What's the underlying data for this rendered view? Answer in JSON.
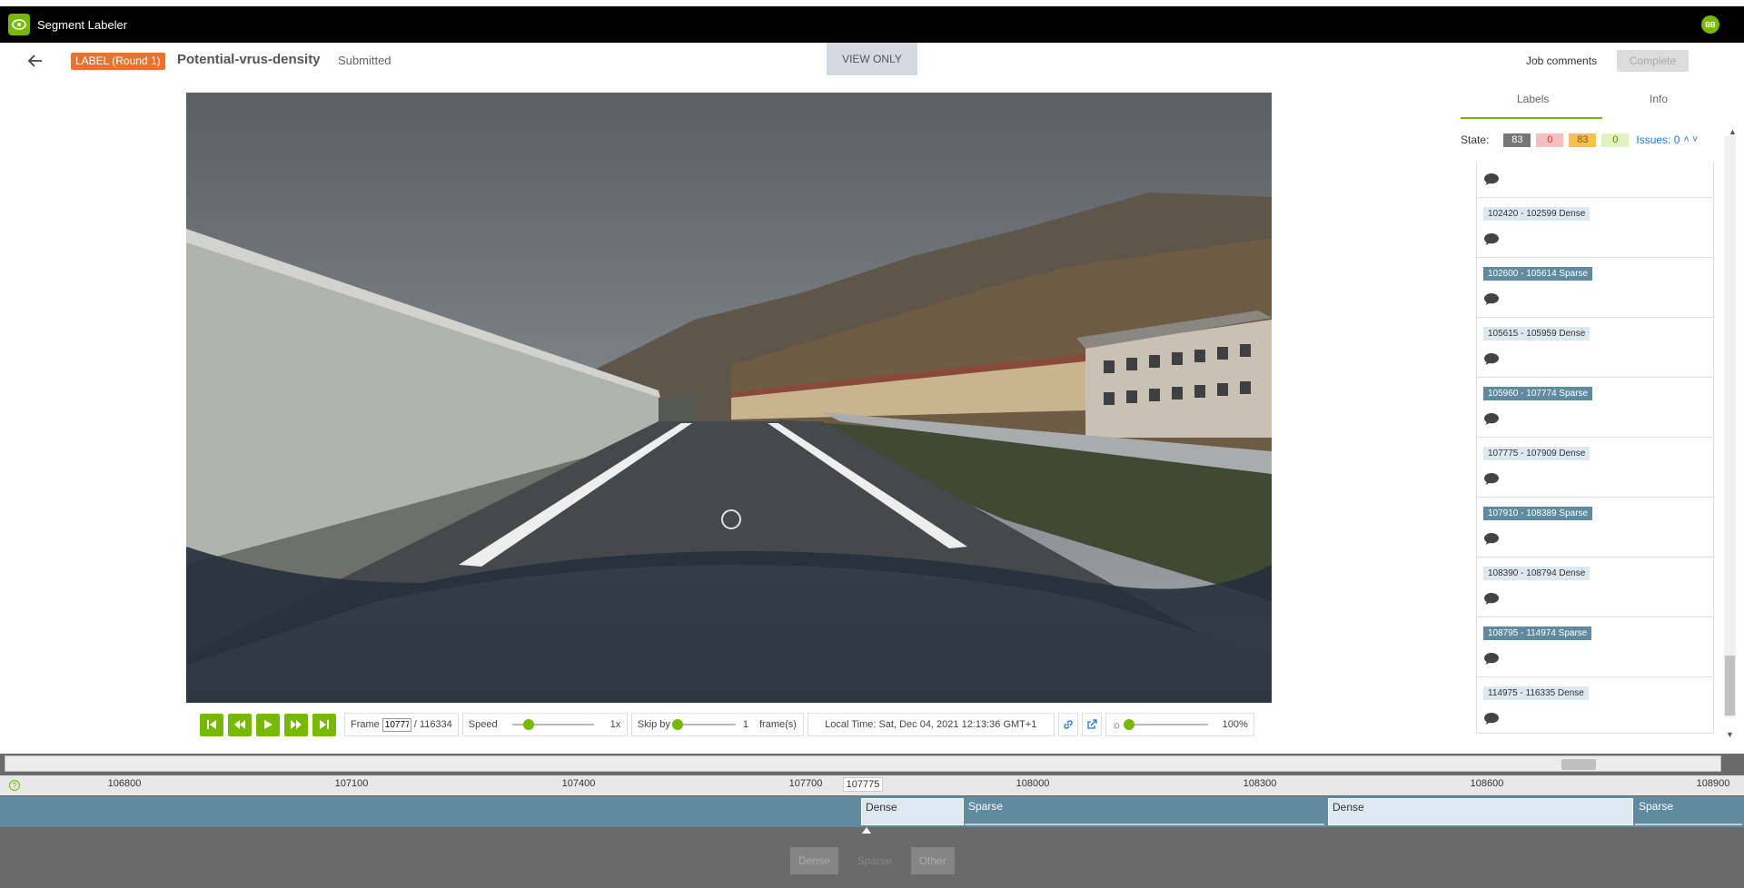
{
  "app": {
    "title": "Segment Labeler",
    "user_initials": "BB"
  },
  "header": {
    "round_badge": "LABEL (Round 1)",
    "job_name": "Potential-vrus-density",
    "status": "Submitted",
    "view_only": "VIEW ONLY",
    "job_comments": "Job comments",
    "complete": "Complete"
  },
  "player": {
    "frame_label": "Frame",
    "frame_value": "10777",
    "frame_total": "/ 116334",
    "speed_label": "Speed",
    "speed_value": "1x",
    "skip_label": "Skip by",
    "skip_value": "1",
    "skip_unit": "frame(s)",
    "local_time": "Local Time: Sat, Dec 04, 2021 12:13:36 GMT+1",
    "brightness": "100%",
    "speed_level": 0.2,
    "skip_level": 0.0,
    "brightness_level": 0.0
  },
  "panel": {
    "tabs": [
      "Labels",
      "Info"
    ],
    "state_label": "State:",
    "state_counts": [
      {
        "value": "83",
        "bg": "#777777",
        "fg": "#ffffff"
      },
      {
        "value": "0",
        "bg": "#f7c0c0",
        "fg": "#cc3333"
      },
      {
        "value": "83",
        "bg": "#f7c04a",
        "fg": "#8a5a00"
      },
      {
        "value": "0",
        "bg": "#dff3c0",
        "fg": "#5a8a00"
      }
    ],
    "issues": "Issues: 0",
    "segments": [
      {
        "label": "",
        "type": ""
      },
      {
        "label": "102420 - 102599 Dense",
        "type": "dense"
      },
      {
        "label": "102600 - 105614 Sparse",
        "type": "sparse"
      },
      {
        "label": "105615 - 105959 Dense",
        "type": "dense"
      },
      {
        "label": "105960 - 107774 Sparse",
        "type": "sparse"
      },
      {
        "label": "107775 - 107909 Dense",
        "type": "dense",
        "active": true
      },
      {
        "label": "107910 - 108389 Sparse",
        "type": "sparse"
      },
      {
        "label": "108390 - 108794 Dense",
        "type": "dense"
      },
      {
        "label": "108795 - 114974 Sparse",
        "type": "sparse"
      },
      {
        "label": "114975 - 116335 Dense",
        "type": "dense"
      }
    ]
  },
  "timeline": {
    "ticks": [
      "106800",
      "107100",
      "107400",
      "107700",
      "108000",
      "108300",
      "108600",
      "108900"
    ],
    "current_frame": "107775",
    "segments": [
      {
        "label": "Dense",
        "type": "d"
      },
      {
        "label": "Sparse",
        "type": "s"
      },
      {
        "label": "Dense",
        "type": "d"
      },
      {
        "label": "Sparse",
        "type": "s"
      }
    ],
    "class_buttons": [
      "Dense",
      "Sparse",
      "Other"
    ]
  },
  "colors": {
    "accent": "#76b900",
    "round_badge": "#e8732a",
    "sparse": "#5f8aa0",
    "dense": "#dde9f1",
    "active": "#f0a800"
  }
}
